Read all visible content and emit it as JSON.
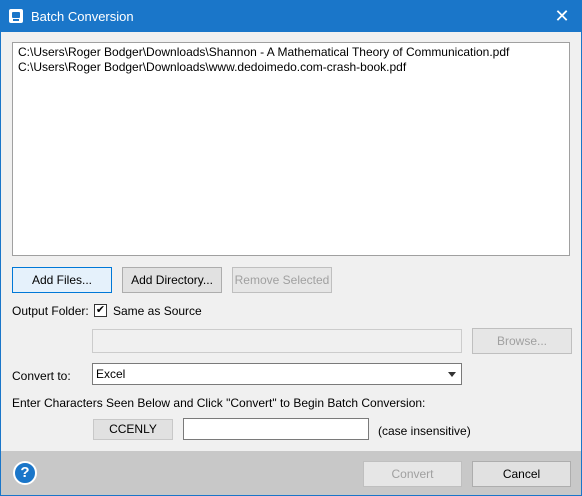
{
  "window": {
    "title": "Batch Conversion",
    "close_glyph": "✕"
  },
  "files": [
    "C:\\Users\\Roger Bodger\\Downloads\\Shannon - A Mathematical Theory of Communication.pdf",
    "C:\\Users\\Roger Bodger\\Downloads\\www.dedoimedo.com-crash-book.pdf"
  ],
  "buttons": {
    "add_files": "Add Files...",
    "add_directory": "Add Directory...",
    "remove_selected": "Remove Selected",
    "browse": "Browse...",
    "convert": "Convert",
    "cancel": "Cancel"
  },
  "output": {
    "label": "Output Folder:",
    "same_as_source_label": "Same as Source",
    "same_as_source_checked": true,
    "check_glyph": "✔",
    "folder_value": ""
  },
  "convert_to": {
    "label": "Convert to:",
    "selected": "Excel"
  },
  "captcha": {
    "instruction": "Enter Characters Seen Below and Click \"Convert\" to Begin Batch Conversion:",
    "code": "CCENLY",
    "input_value": "",
    "hint": "(case insensitive)"
  },
  "help": {
    "glyph": "?"
  },
  "icons": {
    "app": "app-icon",
    "close": "close-icon",
    "dropdown": "chevron-down-icon",
    "help": "help-icon",
    "check": "checkmark-icon"
  },
  "colors": {
    "accent": "#1a76c9",
    "footer": "#c8c8c8",
    "window": "#f0f0f0"
  }
}
